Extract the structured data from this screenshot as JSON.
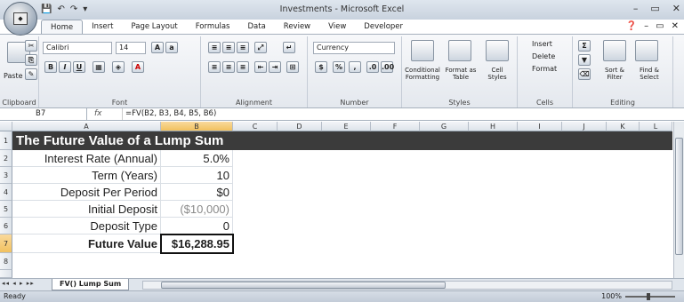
{
  "window": {
    "title": "Investments - Microsoft Excel",
    "controls": [
      "–",
      "▭",
      "✕"
    ]
  },
  "qat": [
    "💾",
    "↶",
    "↷",
    "▾"
  ],
  "tabs": [
    "Home",
    "Insert",
    "Page Layout",
    "Formulas",
    "Data",
    "Review",
    "View",
    "Developer"
  ],
  "tabs_right": [
    "❓",
    "–",
    "▭",
    "✕"
  ],
  "ribbon": {
    "clipboard": {
      "label": "Clipboard",
      "paste": "Paste"
    },
    "font": {
      "label": "Font",
      "name": "Calibri",
      "size": "14"
    },
    "alignment": {
      "label": "Alignment"
    },
    "number": {
      "label": "Number",
      "format": "Currency",
      "buttons": [
        "$",
        "%",
        ","
      ]
    },
    "styles": {
      "label": "Styles",
      "items": [
        "Conditional Formatting",
        "Format as Table",
        "Cell Styles"
      ]
    },
    "cells": {
      "label": "Cells",
      "items": [
        "Insert",
        "Delete",
        "Format"
      ]
    },
    "editing": {
      "label": "Editing",
      "items": [
        "Sort & Filter",
        "Find & Select"
      ]
    }
  },
  "formula_bar": {
    "name_box": "B7",
    "fx": "fx",
    "formula": "=FV(B2, B3, B4, B5, B6)"
  },
  "columns": [
    "A",
    "B",
    "C",
    "D",
    "E",
    "F",
    "G",
    "H",
    "I",
    "J",
    "K",
    "L"
  ],
  "rows": [
    "1",
    "2",
    "3",
    "4",
    "5",
    "6",
    "7",
    "8"
  ],
  "sheet": {
    "title": "The Future Value of a Lump Sum",
    "labels": [
      "Interest Rate (Annual)",
      "Term (Years)",
      "Deposit Per Period",
      "Initial Deposit",
      "Deposit Type",
      "Future Value"
    ],
    "values": [
      "5.0%",
      "10",
      "$0",
      "($10,000)",
      "0",
      "$16,288.95"
    ]
  },
  "sheet_tab": "FV() Lump Sum",
  "status": {
    "ready": "Ready",
    "zoom": "100%"
  },
  "colors": {
    "banner": "#3b3b3b",
    "negative": "#8a8a8a"
  }
}
